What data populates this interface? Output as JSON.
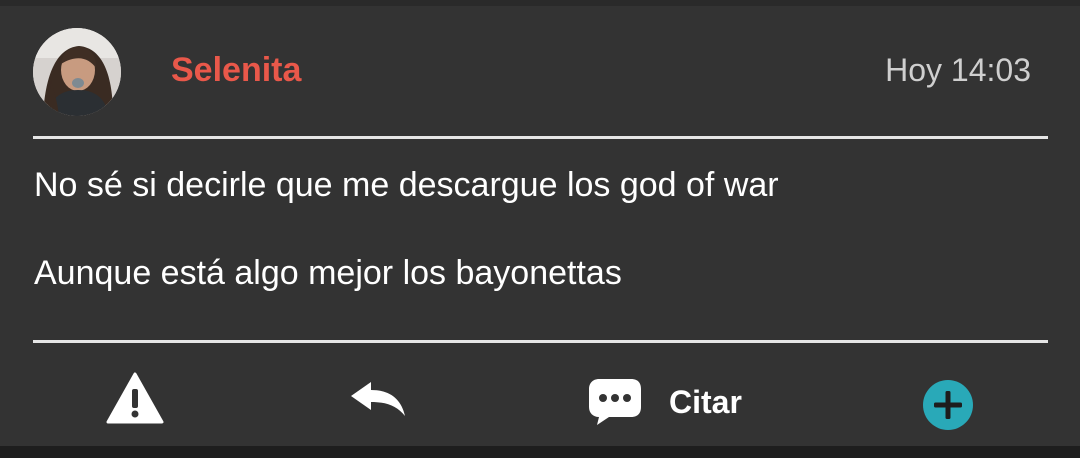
{
  "post": {
    "author": "Selenita",
    "timestamp": "Hoy 14:03",
    "author_color": "#e9584a",
    "paragraphs": [
      "No sé si decirle que me descargue los god of war",
      "Aunque está algo mejor los bayonettas"
    ]
  },
  "actions": {
    "report_icon": "warning-icon",
    "reply_icon": "reply-arrow-icon",
    "quote_icon": "speech-bubble-icon",
    "quote_label": "Citar",
    "add_icon": "plus-circle-icon",
    "add_color": "#29a9b8"
  }
}
